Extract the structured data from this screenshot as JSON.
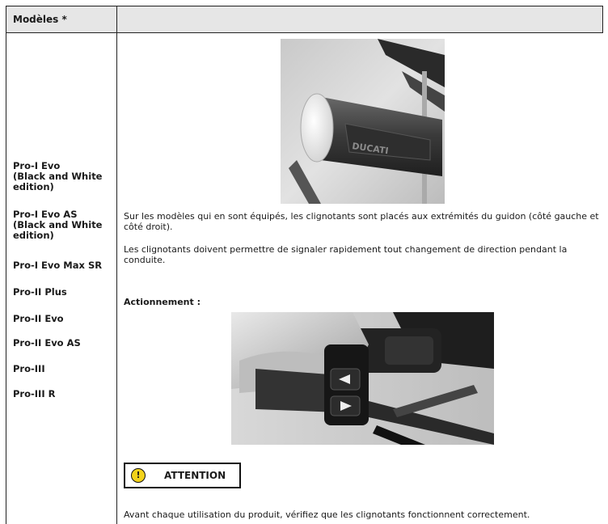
{
  "table": {
    "header_left": "Modèles *",
    "models": [
      "Pro-I Evo\n(Black and White\nedition)",
      "Pro-I Evo AS\n(Black and White\nedition)",
      "Pro-I Evo Max SR",
      "Pro-II Plus",
      "Pro-II Evo",
      "Pro-II Evo AS",
      "Pro-III",
      "Pro-III R"
    ]
  },
  "content": {
    "image1_brand": "DUCATI",
    "para1": "Sur les modèles qui en sont équipés, les clignotants sont placés aux extrémités du guidon (côté gauche et côté droit).",
    "para2": "Les clignotants doivent permettre de signaler rapidement tout changement de direction pendant la conduite.",
    "actuation_label": "Actionnement :",
    "warning": {
      "icon": "warning-icon",
      "symbol": "!",
      "text": "ATTENTION"
    },
    "final_note": "Avant chaque utilisation du produit, vérifiez que les clignotants fonctionnent correctement."
  },
  "colors": {
    "header_bg": "#e6e6e6",
    "warning_yellow": "#f2d21b",
    "border": "#222222"
  }
}
